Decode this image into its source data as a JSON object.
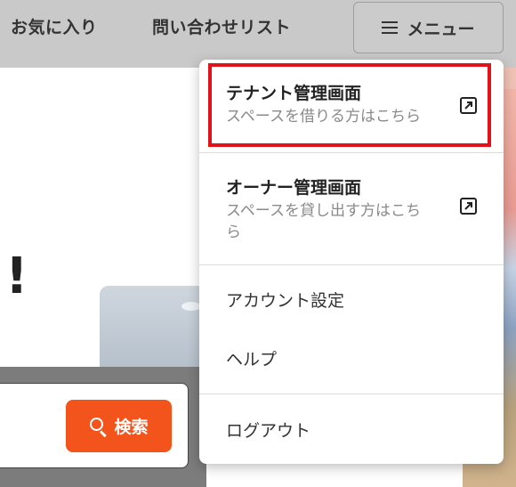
{
  "header": {
    "favorites_label": "お気に入り",
    "inquiry_list_label": "問い合わせリスト",
    "menu_label": "メニュー"
  },
  "background": {
    "exclaim": "!",
    "search_button_label": "検索"
  },
  "menu": {
    "tenant": {
      "title": "テナント管理画面",
      "subtitle": "スペースを借りる方はこちら"
    },
    "owner": {
      "title": "オーナー管理画面",
      "subtitle_line1": "スペースを貸し出す方はこち",
      "subtitle_line2": "ら"
    },
    "account_settings": "アカウント設定",
    "help": "ヘルプ",
    "logout": "ログアウト"
  },
  "colors": {
    "header_bg": "#c9c9c9",
    "highlight_border": "#e0121a",
    "search_button": "#f2541b"
  },
  "icons": [
    "hamburger-icon",
    "external-link-icon",
    "search-icon"
  ]
}
